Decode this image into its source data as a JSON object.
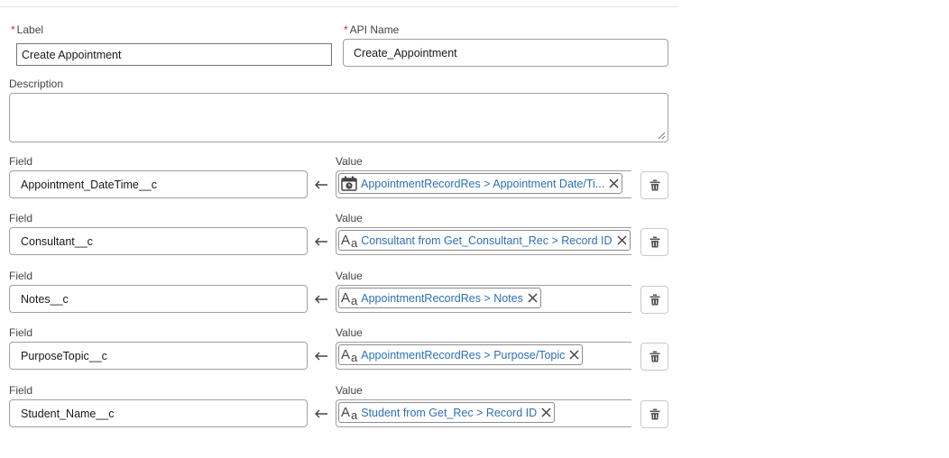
{
  "header": {
    "label_field": {
      "required_mark": "*",
      "label": "Label",
      "value": "Create Appointment"
    },
    "api_name_field": {
      "required_mark": "*",
      "label": "API Name",
      "value": "Create_Appointment"
    },
    "description_field": {
      "label": "Description",
      "value": ""
    }
  },
  "assignments": [
    {
      "field_label": "Field",
      "field_value": "Appointment_DateTime__c",
      "value_label": "Value",
      "value_icon": "calendar-time-icon",
      "value_text": "AppointmentRecordRes > Appointment Date/Ti..."
    },
    {
      "field_label": "Field",
      "field_value": "Consultant__c",
      "value_label": "Value",
      "value_icon": "text-type-icon",
      "value_text": "Consultant from Get_Consultant_Rec > Record ID"
    },
    {
      "field_label": "Field",
      "field_value": "Notes__c",
      "value_label": "Value",
      "value_icon": "text-type-icon",
      "value_text": "AppointmentRecordRes > Notes"
    },
    {
      "field_label": "Field",
      "field_value": "PurposeTopic__c",
      "value_label": "Value",
      "value_icon": "text-type-icon",
      "value_text": "AppointmentRecordRes > Purpose/Topic"
    },
    {
      "field_label": "Field",
      "field_value": "Student_Name__c",
      "value_label": "Value",
      "value_icon": "text-type-icon",
      "value_text": "Student from Get_Rec > Record ID"
    }
  ],
  "icons": {
    "required": "asterisk",
    "assign_arrow": "arrow-left-icon",
    "remove_pill": "close-icon",
    "delete_row": "trash-icon",
    "textarea_resize": "resize-handle-icon"
  },
  "colors": {
    "pill_text": "#2e6fb7",
    "required": "#c23934",
    "border": "#a0a0a0"
  }
}
